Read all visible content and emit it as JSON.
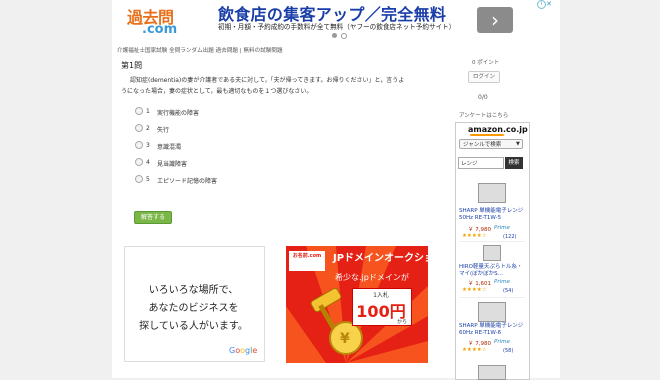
{
  "banner": {
    "logo_top": "過去問",
    "logo_bot": ".com",
    "ad_title": "飲食店の集客アップ／完全無料",
    "ad_subtitle": "初期・月額・予約成約の手数料が全て無料（ヤフーの飲食店ネット予約サイト）",
    "arrow": "›",
    "adchoices": "i",
    "close": "✕"
  },
  "breadcrumb": "介護福祉士国家試験 全問ランダム出題 過去問題 | 無料の試験問題",
  "question": {
    "number": "第1問",
    "text_line1": "認知症(dementia)の妻が介護者である夫に対して，「夫が帰ってきます。お帰りください」と，言うよ",
    "text_line2": "うになった場合，妻の症状として，最も適切なものを１つ選びなさい。",
    "options": [
      {
        "num": "1",
        "label": "実行機能の障害"
      },
      {
        "num": "2",
        "label": "失行"
      },
      {
        "num": "3",
        "label": "意識混濁"
      },
      {
        "num": "4",
        "label": "見当識障害"
      },
      {
        "num": "5",
        "label": "エピソード記憶の障害"
      }
    ],
    "answer_button": "解答する"
  },
  "google_ad": {
    "line1": "いろいろな場所で、",
    "line2": "あなたのビジネスを",
    "line3": "探している人がいます。",
    "logo": "Google",
    "colors": [
      "#4285f4",
      "#ea4335",
      "#fbbc05",
      "#4285f4",
      "#34a853",
      "#ea4335"
    ]
  },
  "jp_ad": {
    "badge": "お名前.com",
    "title": "JPドメインオークション",
    "subtitle": "希少な.jpドメインが",
    "box_label": "1入札",
    "price": "100円",
    "box_suffix": "から"
  },
  "sidebar": {
    "points": "0 ポイント",
    "login": "ログイン",
    "score": "0/0",
    "survey": "アンケートはこちら"
  },
  "amazon": {
    "logo": "amazon.co.jp",
    "genre_select": "ジャンルで検索",
    "search_value": "レンジ",
    "search_button": "検索",
    "products": [
      {
        "title": "SHARP 単機能電子レンジ 50Hz RE-T1W-5",
        "price": "￥ 7,980",
        "prime": "Prime",
        "stars": "★★★★☆",
        "count": "(122)"
      },
      {
        "title": "HIRO軽量天ぷらトル糸・マイ(ぼかぼかS...",
        "price": "￥ 1,601",
        "prime": "Prime",
        "stars": "★★★★☆",
        "count": "(54)"
      },
      {
        "title": "SHARP 単機能電子レンジ 60Hz RE-T1W-6",
        "price": "￥ 7,980",
        "prime": "Prime",
        "stars": "★★★★☆",
        "count": "(58)"
      }
    ]
  }
}
